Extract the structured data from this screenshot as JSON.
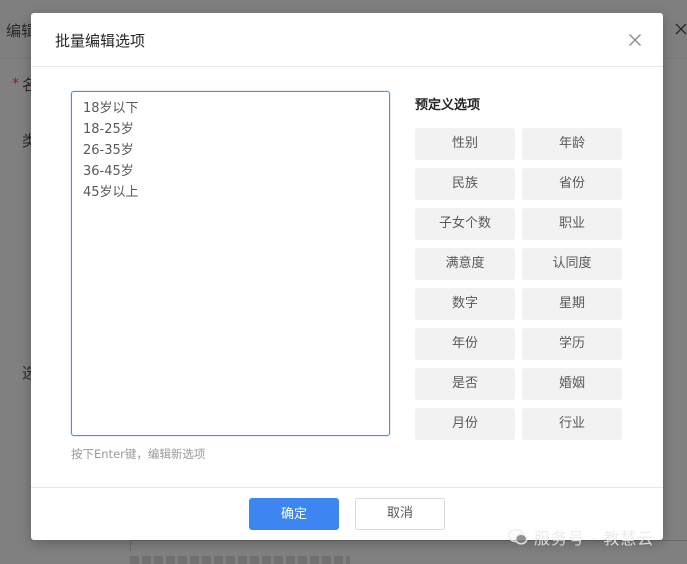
{
  "background": {
    "header_text": "编辑",
    "required_mark": "*",
    "name_label": "名",
    "type_label": "类",
    "options_label": "选"
  },
  "modal": {
    "title": "批量编辑选项",
    "close_icon": "close-icon",
    "textarea": {
      "lines": [
        "18岁以下",
        "18-25岁",
        "26-35岁",
        "36-45岁",
        "45岁以上"
      ],
      "hint": "按下Enter键，编辑新选项"
    },
    "presets": {
      "title": "预定义选项",
      "items": [
        {
          "label": "性别"
        },
        {
          "label": "年龄"
        },
        {
          "label": "民族"
        },
        {
          "label": "省份"
        },
        {
          "label": "子女个数"
        },
        {
          "label": "职业"
        },
        {
          "label": "满意度"
        },
        {
          "label": "认同度"
        },
        {
          "label": "数字"
        },
        {
          "label": "星期"
        },
        {
          "label": "年份"
        },
        {
          "label": "学历"
        },
        {
          "label": "是否"
        },
        {
          "label": "婚姻"
        },
        {
          "label": "月份"
        },
        {
          "label": "行业"
        }
      ]
    },
    "footer": {
      "ok_label": "确定",
      "cancel_label": "取消"
    }
  },
  "watermark": {
    "text": "服务号 · 教慧云",
    "icon": "wechat-icon"
  },
  "colors": {
    "primary": "#3d86f2",
    "overlay": "#808080",
    "preset_bg": "#f2f2f2",
    "textarea_border": "#4f8fd8"
  }
}
